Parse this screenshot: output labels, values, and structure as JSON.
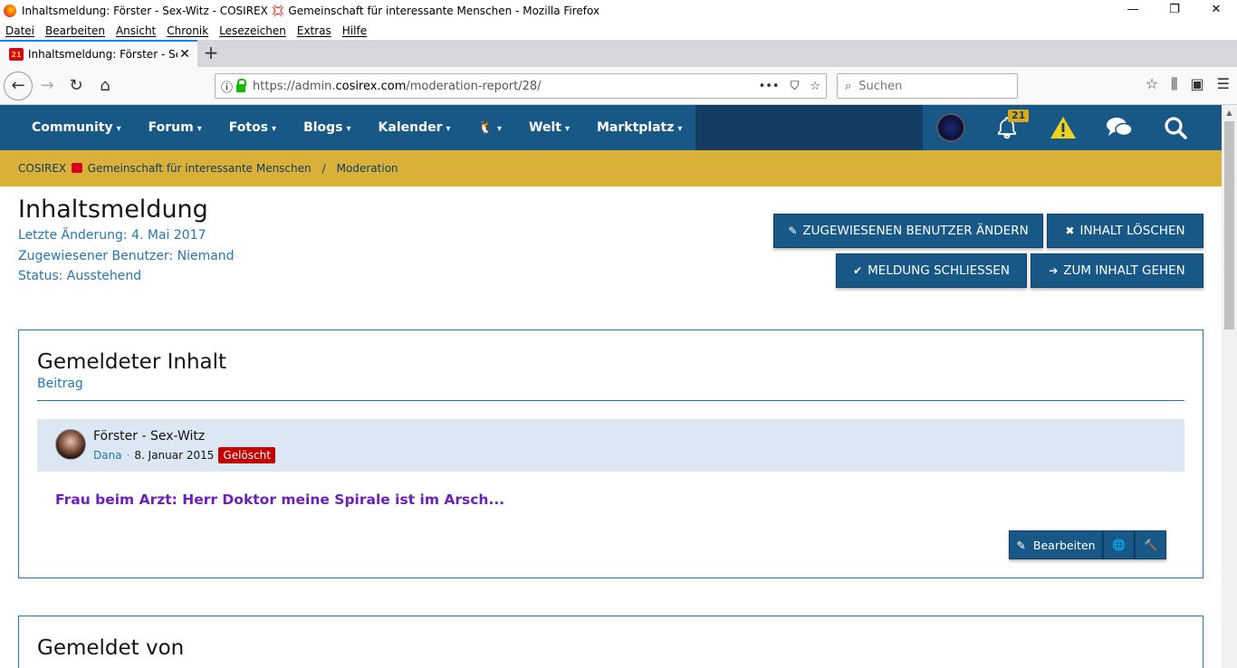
{
  "window": {
    "title": "Inhaltsmeldung: Förster - Sex-Witz - COSIREX 💢 Gemeinschaft für interessante Menschen - Mozilla Firefox",
    "minimize": "—",
    "restore": "❐",
    "close": "✕"
  },
  "menubar": [
    "Datei",
    "Bearbeiten",
    "Ansicht",
    "Chronik",
    "Lesezeichen",
    "Extras",
    "Hilfe"
  ],
  "tab": {
    "title": "Inhaltsmeldung: Förster - Sex-W",
    "favicon": "21",
    "close": "✕",
    "new": "+"
  },
  "navbar": {
    "back": "←",
    "forward": "→",
    "reload": "↻",
    "home": "⌂",
    "url_prefix": "https://admin.",
    "url_domain": "cosirex.com",
    "url_path": "/moderation-report/28/",
    "more": "•••",
    "pocket": "⛉",
    "star": "☆",
    "search_placeholder": "Suchen",
    "info": "ⓘ"
  },
  "site_nav": {
    "items": [
      {
        "label": "Community"
      },
      {
        "label": "Forum"
      },
      {
        "label": "Fotos"
      },
      {
        "label": "Blogs"
      },
      {
        "label": "Kalender"
      },
      {
        "label": "🐧"
      },
      {
        "label": "Welt"
      },
      {
        "label": "Marktplatz"
      }
    ],
    "chevron": "▾",
    "alerts_badge": "21",
    "bell": "🔔",
    "warning": "⚠",
    "chat": "💬",
    "search": "🔍"
  },
  "breadcrumb": {
    "home_label_a": "COSIREX",
    "home_label_b": "Gemeinschaft für interessante Menschen",
    "separator": "/",
    "current": "Moderation"
  },
  "report": {
    "title": "Inhaltsmeldung",
    "last_change": "Letzte Änderung: 4. Mai 2017",
    "assigned": "Zugewiesener Benutzer: Niemand",
    "status": "Status: Ausstehend"
  },
  "actions": {
    "change_assigned": "ZUGEWIESENEN BENUTZER ÄNDERN",
    "delete_content": "INHALT LÖSCHEN",
    "close_report": "MELDUNG SCHLIESSEN",
    "go_to_content": "ZUM INHALT GEHEN",
    "pencil": "✎",
    "x": "✖",
    "check": "✔",
    "arrow": "➔"
  },
  "reported_content": {
    "heading": "Gemeldeter Inhalt",
    "type": "Beitrag",
    "post_title": "Förster - Sex-Witz",
    "author": "Dana",
    "date": "8. Januar 2015",
    "deleted_badge": "Gelöscht",
    "body": "Frau beim Arzt: Herr Doktor meine Spirale ist im Arsch...",
    "edit_label": "Bearbeiten",
    "globe": "🌐",
    "hammer": "🔨"
  },
  "reported_by": {
    "heading": "Gemeldet von"
  }
}
